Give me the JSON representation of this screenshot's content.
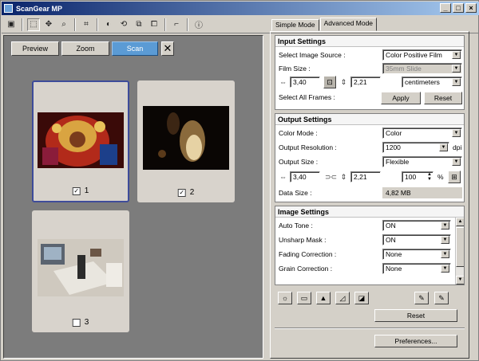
{
  "window": {
    "title": "ScanGear MP"
  },
  "preview": {
    "buttons": {
      "preview": "Preview",
      "zoom": "Zoom",
      "scan": "Scan"
    },
    "frames": [
      {
        "number": "1",
        "checked": true,
        "selected": true
      },
      {
        "number": "2",
        "checked": true,
        "selected": false
      },
      {
        "number": "3",
        "checked": false,
        "selected": false
      }
    ]
  },
  "tabs": {
    "simple": "Simple Mode",
    "advanced": "Advanced Mode"
  },
  "input": {
    "title": "Input Settings",
    "source_label": "Select Image Source :",
    "source_value": "Color Positive Film",
    "film_label": "Film Size :",
    "film_value": "35mm Slide",
    "width": "3,40",
    "height": "2,21",
    "unit": "centimeters",
    "all_frames_label": "Select All Frames :",
    "apply": "Apply",
    "reset": "Reset"
  },
  "output": {
    "title": "Output Settings",
    "mode_label": "Color Mode :",
    "mode_value": "Color",
    "res_label": "Output Resolution :",
    "res_value": "1200",
    "res_unit": "dpi",
    "size_label": "Output Size :",
    "size_value": "Flexible",
    "width": "3,40",
    "height": "2,21",
    "scale": "100",
    "scale_unit": "%",
    "datasize_label": "Data Size :",
    "datasize_value": "4,82 MB"
  },
  "image": {
    "title": "Image Settings",
    "rows": [
      {
        "label": "Auto Tone :",
        "value": "ON"
      },
      {
        "label": "Unsharp Mask :",
        "value": "ON"
      },
      {
        "label": "Fading Correction :",
        "value": "None"
      },
      {
        "label": "Grain Correction :",
        "value": "None"
      }
    ]
  },
  "footer": {
    "reset": "Reset",
    "preferences": "Preferences..."
  }
}
